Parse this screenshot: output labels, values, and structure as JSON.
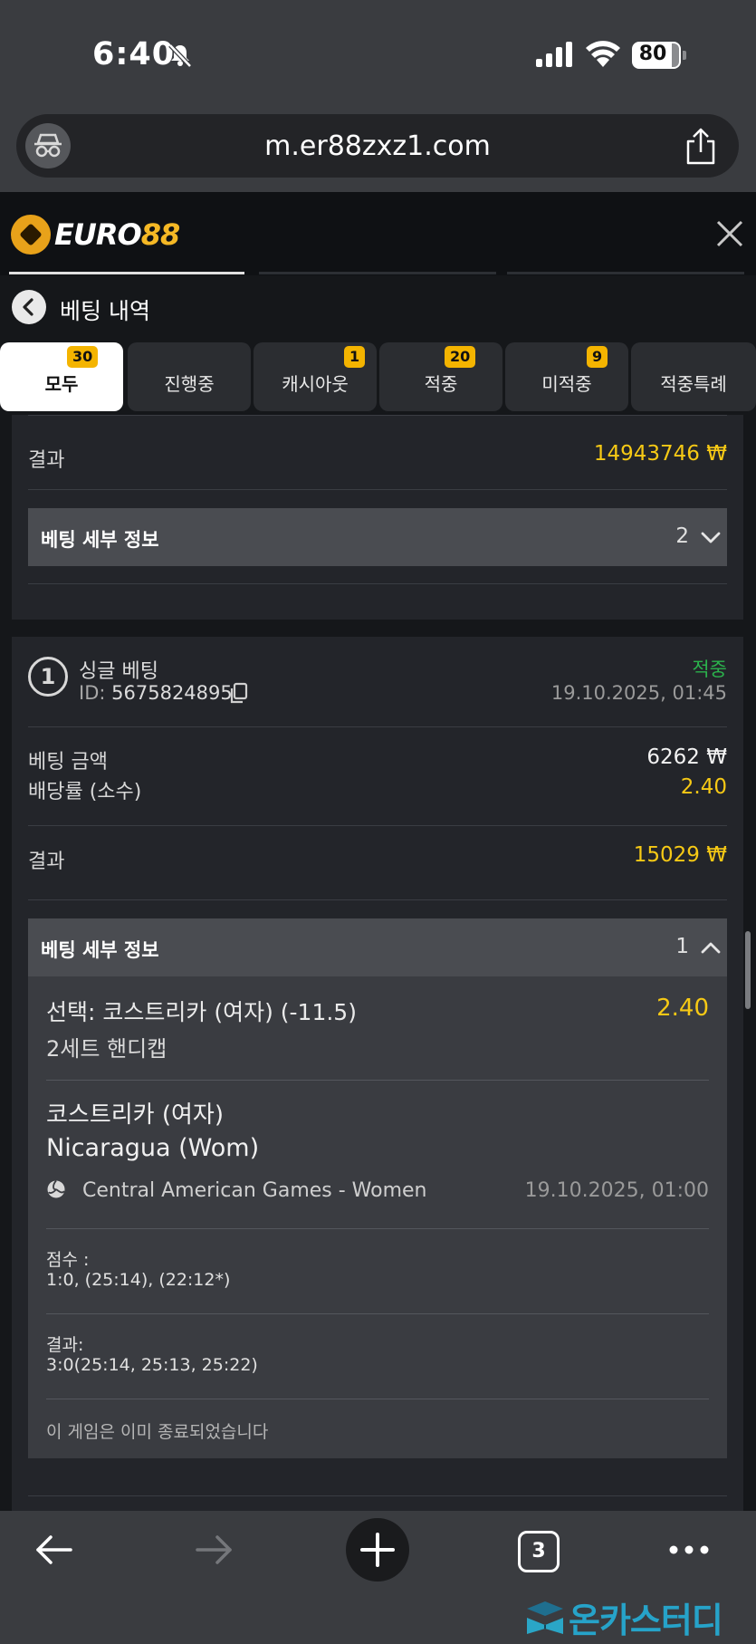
{
  "status_bar": {
    "time": "6:40",
    "battery": "80"
  },
  "browser": {
    "url": "m.er88zxz1.com"
  },
  "app": {
    "logo_word": "EURO",
    "logo_num": "88"
  },
  "page": {
    "title": "베팅 내역"
  },
  "tabs": [
    {
      "label": "모두",
      "badge": "30",
      "active": true
    },
    {
      "label": "진행중",
      "badge": ""
    },
    {
      "label": "캐시아웃",
      "badge": "1"
    },
    {
      "label": "적중",
      "badge": "20"
    },
    {
      "label": "미적중",
      "badge": "9"
    },
    {
      "label": "적중특례",
      "badge": ""
    }
  ],
  "prev_bet": {
    "result_label": "결과",
    "result_value": "14943746 ₩",
    "details_title": "베팅 세부 정보",
    "details_count": "2"
  },
  "bet": {
    "number": "1",
    "type": "싱글 베팅",
    "id_label": "ID:",
    "id_value": "5675824895",
    "status": "적중",
    "datetime": "19.10.2025, 01:45",
    "stake_label": "베팅 금액",
    "stake_value": "6262 ₩",
    "odds_label": "배당률 (소수)",
    "odds_value": "2.40",
    "result_label": "결과",
    "result_value": "15029 ₩",
    "details_title": "베팅 세부 정보",
    "details_count": "1",
    "selection": {
      "pick": "선택: 코스트리카 (여자) (-11.5)",
      "market": "2세트 핸디캡",
      "odds": "2.40",
      "team1": "코스트리카 (여자)",
      "team2": "Nicaragua (Wom)",
      "league": "Central American Games - Women",
      "event_time": "19.10.2025, 01:00",
      "score_label": "점수 :",
      "score_value": "1:0, (25:14), (22:12*)",
      "final_label": "결과:",
      "final_value": "3:0(25:14, 25:13, 25:22)",
      "note": "이 게임은 이미 종료되었습니다"
    }
  },
  "bottom_nav": {
    "tab_count": "3"
  },
  "watermark": "온카스터디",
  "colors": {
    "accent_yellow": "#f6c915",
    "win_green": "#2bb24c",
    "badge": "#f4b400"
  }
}
